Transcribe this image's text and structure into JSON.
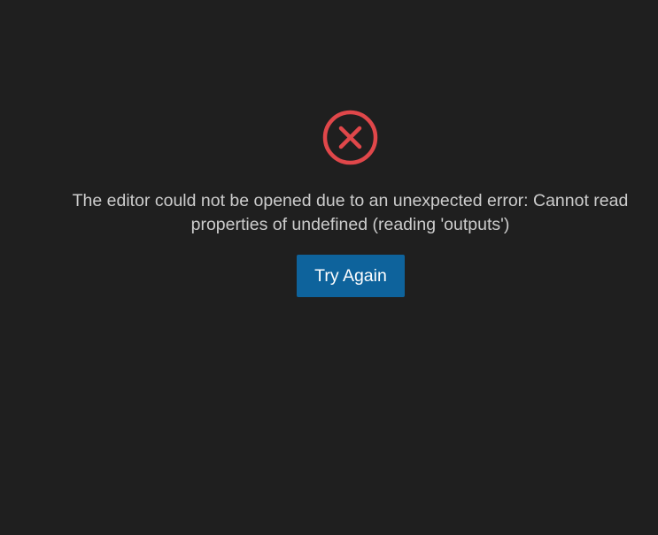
{
  "error": {
    "icon": "error-circle-x-icon",
    "icon_color": "#e0474a",
    "message": "The editor could not be opened due to an unexpected error: Cannot read properties of undefined (reading 'outputs')"
  },
  "actions": {
    "try_again_label": "Try Again",
    "button_color": "#0e639c"
  },
  "colors": {
    "background": "#1f1f1f",
    "text": "#cccccc"
  }
}
